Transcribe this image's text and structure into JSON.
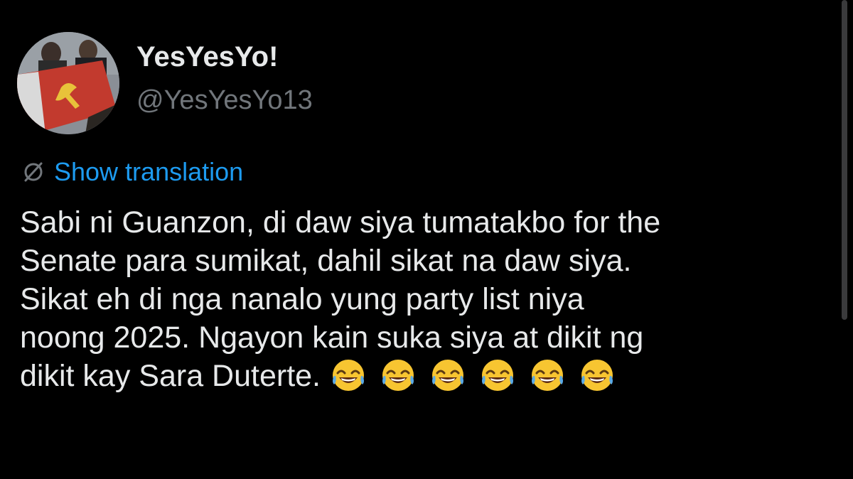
{
  "author": {
    "display_name": "YesYesYo!",
    "handle": "@YesYesYo13"
  },
  "translate": {
    "icon": "translate-globe-icon",
    "label": "Show translation"
  },
  "tweet": {
    "lines": [
      "Sabi ni Guanzon, di daw siya tumatakbo for the",
      "Senate para sumikat, dahil sikat na daw siya.",
      "Sikat eh di nga nanalo yung party list niya",
      "noong 2025. Ngayon kain suka siya at dikit ng",
      "dikit kay Sara Duterte."
    ],
    "emoji_icon": "face-with-tears-of-joy-icon"
  },
  "colors": {
    "background": "#000000",
    "primary_text": "#e7e9ea",
    "secondary_text": "#71767b",
    "link": "#1d9bf0"
  }
}
